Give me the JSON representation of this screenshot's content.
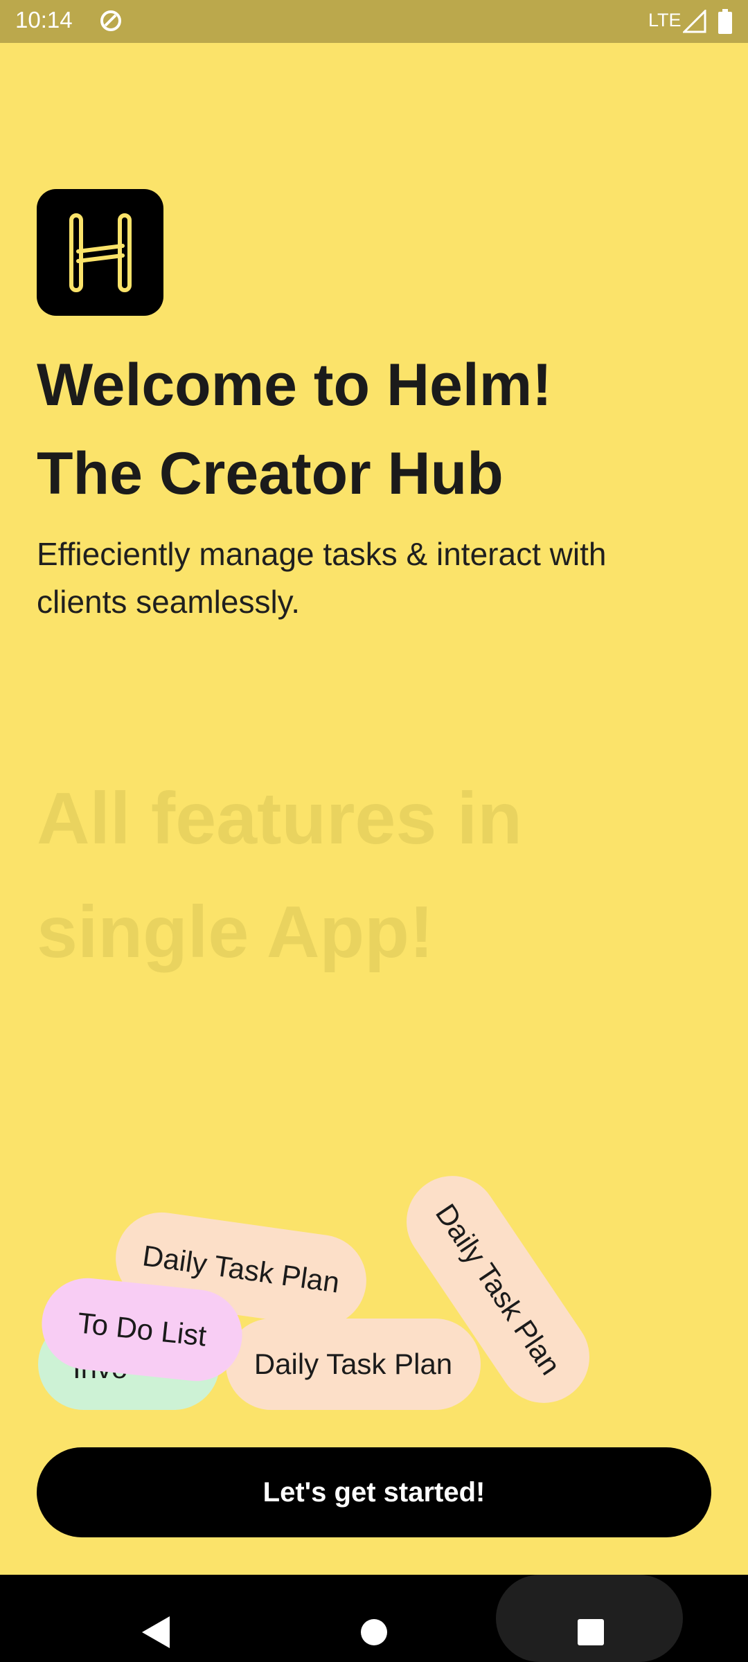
{
  "status_bar": {
    "time": "10:14",
    "network": "LTE",
    "icons": [
      "sync-icon",
      "signal-icon",
      "battery-icon"
    ]
  },
  "logo": {
    "icon": "helm-logo-icon"
  },
  "hero": {
    "title_line_1": "Welcome to Helm!",
    "title_line_2": "The Creator Hub",
    "subtitle": "Effieciently manage tasks & interact with clients seamlessly."
  },
  "features": {
    "line_1": "All features in",
    "line_2": "single App!"
  },
  "pills": {
    "partial_green": "Invo",
    "daily_1": "Daily Task Plan",
    "daily_2": "Daily Task Plan",
    "daily_3": "Daily Task Plan",
    "todo": "To Do List"
  },
  "cta": {
    "label": "Let's get started!"
  },
  "colors": {
    "background": "#FBE36A",
    "status_bar": "#BBA84C",
    "button": "#000000",
    "pill_peach": "#FCDFC8",
    "pill_pink": "#F8CDF4",
    "pill_green": "#CDF2D5",
    "faded_text": "#E9D35F"
  },
  "nav": {
    "icons": [
      "back-icon",
      "home-icon",
      "recents-icon"
    ]
  }
}
